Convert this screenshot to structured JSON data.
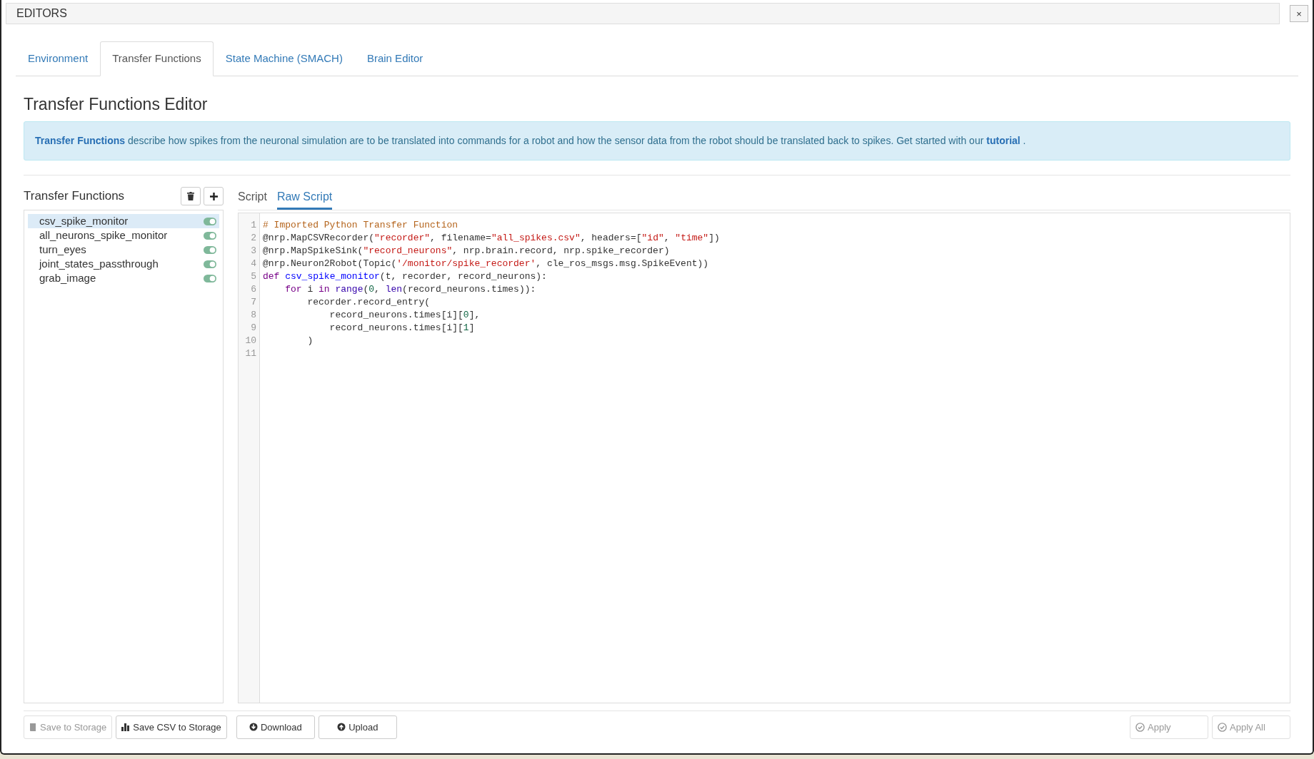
{
  "window": {
    "title": "EDITORS",
    "close": "×"
  },
  "tabs": [
    {
      "label": "Environment",
      "selected": false
    },
    {
      "label": "Transfer Functions",
      "selected": true
    },
    {
      "label": "State Machine (SMACH)",
      "selected": false
    },
    {
      "label": "Brain Editor",
      "selected": false
    }
  ],
  "heading": "Transfer Functions Editor",
  "info": {
    "text": "**Transfer Functions** describe how spikes from the neuronal simulation are to be translated into commands for a robot and how the sensor data from the robot should be translated back to spikes. Get started with our",
    "link": "tutorial",
    "tail": "."
  },
  "sidebar": {
    "title": "Transfer Functions",
    "items": [
      {
        "label": "csv_spike_monitor",
        "selected": true,
        "on": true
      },
      {
        "label": "all_neurons_spike_monitor",
        "selected": false,
        "on": true
      },
      {
        "label": "turn_eyes",
        "selected": false,
        "on": true
      },
      {
        "label": "joint_states_passthrough",
        "selected": false,
        "on": true
      },
      {
        "label": "grab_image",
        "selected": false,
        "on": true
      }
    ]
  },
  "editor_tabs": [
    {
      "label": "Script",
      "selected": false
    },
    {
      "label": "Raw Script",
      "selected": true
    }
  ],
  "code": [
    {
      "number": "1",
      "tokens": [
        {
          "kind": "comment",
          "text": "# Imported Python Transfer Function"
        }
      ]
    },
    {
      "number": "2",
      "tokens": [
        {
          "kind": "plain",
          "text": "@nrp.MapCSVRecorder("
        },
        {
          "kind": "string",
          "text": "\"recorder\""
        },
        {
          "kind": "plain",
          "text": ", filename="
        },
        {
          "kind": "string",
          "text": "\"all_spikes.csv\""
        },
        {
          "kind": "plain",
          "text": ", headers=["
        },
        {
          "kind": "string",
          "text": "\"id\""
        },
        {
          "kind": "plain",
          "text": ", "
        },
        {
          "kind": "string",
          "text": "\"time\""
        },
        {
          "kind": "plain",
          "text": "])"
        }
      ]
    },
    {
      "number": "3",
      "tokens": [
        {
          "kind": "plain",
          "text": "@nrp.MapSpikeSink("
        },
        {
          "kind": "string",
          "text": "\"record_neurons\""
        },
        {
          "kind": "plain",
          "text": ", nrp.brain.record, nrp.spike_recorder)"
        }
      ]
    },
    {
      "number": "4",
      "tokens": [
        {
          "kind": "plain",
          "text": "@nrp.Neuron2Robot(Topic("
        },
        {
          "kind": "string",
          "text": "'/monitor/spike_recorder'"
        },
        {
          "kind": "plain",
          "text": ", cle_ros_msgs.msg.SpikeEvent))"
        }
      ]
    },
    {
      "number": "5",
      "tokens": [
        {
          "kind": "keyword",
          "text": "def "
        },
        {
          "kind": "def",
          "text": "csv_spike_monitor"
        },
        {
          "kind": "plain",
          "text": "(t, recorder, record_neurons):"
        }
      ]
    },
    {
      "number": "6",
      "tokens": [
        {
          "kind": "keyword",
          "text": "    for"
        },
        {
          "kind": "plain",
          "text": " i "
        },
        {
          "kind": "keyword",
          "text": "in "
        },
        {
          "kind": "builtin",
          "text": "range"
        },
        {
          "kind": "plain",
          "text": "("
        },
        {
          "kind": "number",
          "text": "0"
        },
        {
          "kind": "plain",
          "text": ", "
        },
        {
          "kind": "builtin",
          "text": "len"
        },
        {
          "kind": "plain",
          "text": "(record_neurons.times)):"
        }
      ]
    },
    {
      "number": "7",
      "tokens": [
        {
          "kind": "plain",
          "text": "        recorder.record_entry("
        }
      ]
    },
    {
      "number": "8",
      "tokens": [
        {
          "kind": "plain",
          "text": "            record_neurons.times[i]["
        },
        {
          "kind": "number",
          "text": "0"
        },
        {
          "kind": "plain",
          "text": "],"
        }
      ]
    },
    {
      "number": "9",
      "tokens": [
        {
          "kind": "plain",
          "text": "            record_neurons.times[i]["
        },
        {
          "kind": "number",
          "text": "1"
        },
        {
          "kind": "plain",
          "text": "]"
        }
      ]
    },
    {
      "number": "10",
      "tokens": [
        {
          "kind": "plain",
          "text": "        )"
        }
      ]
    },
    {
      "number": "11"
    }
  ],
  "footer_left": [
    {
      "label": "Save to Storage",
      "disabled": true
    },
    {
      "label": "Save CSV to Storage",
      "disabled": false
    },
    {
      "label": "Download",
      "disabled": false
    },
    {
      "label": "Upload",
      "disabled": false
    }
  ],
  "footer_right": [
    {
      "label": "Apply",
      "disabled": true
    },
    {
      "label": "Apply All",
      "disabled": true
    }
  ]
}
